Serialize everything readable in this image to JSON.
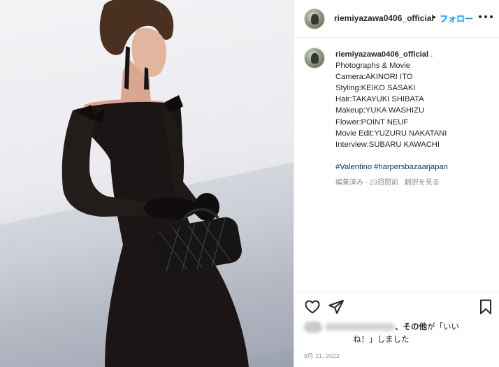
{
  "post": {
    "username": "riemiyazawa0406_official",
    "header_separator": "•",
    "follow_label": "フォロー",
    "caption": {
      "username": "riemiyazawa0406_official",
      "suffix": ".",
      "lines": [
        "Photographs & Movie",
        "Camera:AKINORI ITO",
        "Styling:KEIKO SASAKI",
        "Hair:TAKAYUKI SHIBATA",
        "Makeup:YUKA WASHIZU",
        "Flower:POINT NEUF",
        "Movie Edit:YUZURU NAKATANI",
        "Interview:SUBARU KAWACHI"
      ],
      "hashtags": [
        "#Valentino",
        "#harpersbazaarjapan"
      ],
      "edited_meta": "編集済み · 23週間前",
      "translate_label": "翻訳を見る"
    },
    "likes": {
      "others_label": "、その他",
      "text_mid": "が「いい",
      "text_end": "ね！」しました"
    },
    "date": "9月 21, 2022"
  },
  "icons": {
    "more": "more-options-icon",
    "like": "heart-icon",
    "share": "paper-plane-icon",
    "save": "bookmark-icon"
  },
  "colors": {
    "follow": "#0095f6",
    "hashtag": "#00376b",
    "muted": "#8e8e8e",
    "text": "#262626"
  }
}
